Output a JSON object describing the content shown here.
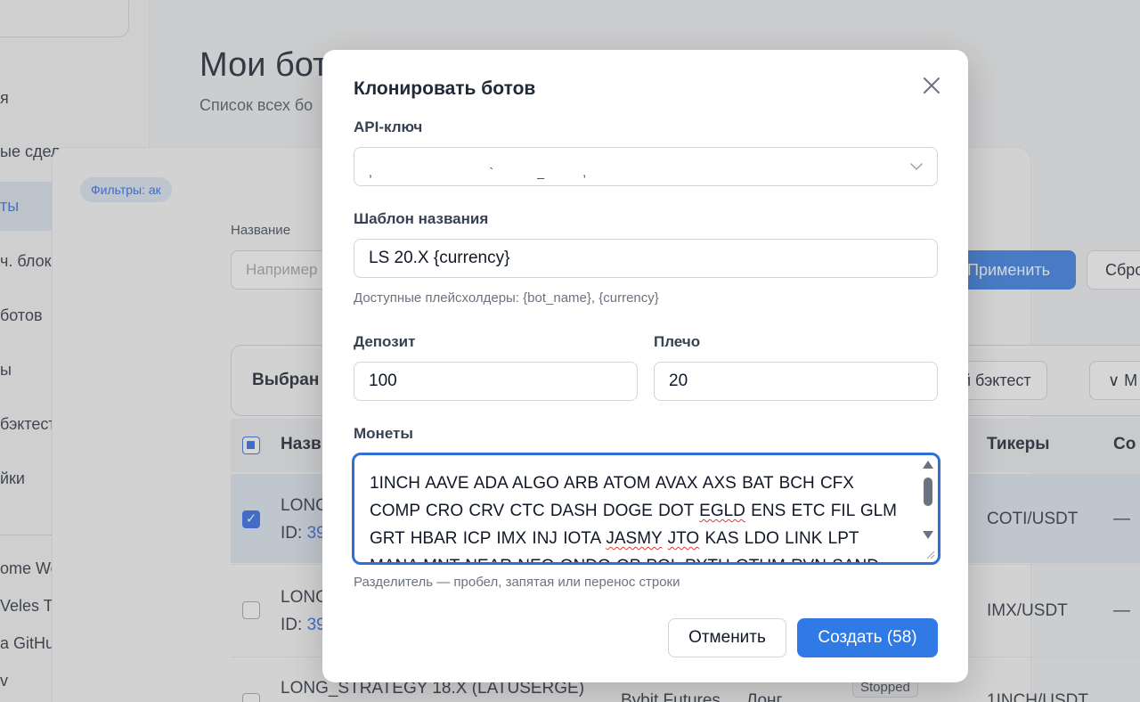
{
  "sidebar": {
    "items": [
      {
        "label": "я"
      },
      {
        "label": "ые сделки"
      },
      {
        "label": "ты"
      },
      {
        "label": "ч. блок."
      },
      {
        "label": " ботов"
      },
      {
        "label": "ы"
      },
      {
        "label": "бэктестов"
      },
      {
        "label": "йки"
      }
    ],
    "links": [
      {
        "label": "ome Web Store"
      },
      {
        "label": " Veles Tools"
      },
      {
        "label": "a GitHub"
      },
      {
        "label": "v"
      }
    ]
  },
  "page": {
    "title": "Мои бот",
    "subtitle": "Список всех бо"
  },
  "filters": {
    "chip": "Фильтры: ак",
    "name_label": "Название",
    "name_placeholder": "Например",
    "apply": "Применить",
    "reset": "Сбро"
  },
  "toolbar": {
    "label": "Выбран",
    "backtest": "ый бэктест",
    "more": "∨  М"
  },
  "table": {
    "headers": {
      "name": "Назв",
      "tickers": "Тикеры",
      "created": "Со"
    },
    "rows": [
      {
        "name": "LONG",
        "id_prefix": "ID: ",
        "id": "39",
        "ticker": "COTI/USDT",
        "created": "—"
      },
      {
        "name": "LONG",
        "id_prefix": "ID: ",
        "id": "39",
        "ticker": "IMX/USDT",
        "created": "—"
      },
      {
        "name": "LONG_STRATEGY 18.X (LATUSERGE)",
        "exchange": "Bybit Futures",
        "direction": "Лонг",
        "status": "Stopped",
        "ticker": "1INCH/USDT"
      }
    ]
  },
  "modal": {
    "title": "Клонировать ботов",
    "api_key_label": "API-ключ",
    "api_key_value": ",                      `        _       ,",
    "template_label": "Шаблон названия",
    "template_value": "LS 20.X {currency}",
    "template_hint": "Доступные плейсхолдеры: {bot_name}, {currency}",
    "deposit_label": "Депозит",
    "deposit_value": "100",
    "leverage_label": "Плечо",
    "leverage_value": "20",
    "coins_label": "Монеты",
    "coins_lines": {
      "l1": "1INCH AAVE ADA ALGO ARB ATOM AVAX AXS BAT BCH CFX",
      "l2a": "COMP CRO CRV CTC DASH DOGE DOT ",
      "l2b": "EGLD",
      "l2c": " ENS ETC FIL GLM",
      "l3a": "GRT HBAR ICP IMX INJ IOTA ",
      "l3b": "JASMY",
      "l3c": " ",
      "l3d": "JTO",
      "l3e": " KAS LDO LINK LPT",
      "l4": "MANA MNT NEAR NEO ONDO OP POL PYTH QTUM RVN SAND"
    },
    "coins_hint": "Разделитель — пробел, запятая или перенос строки",
    "cancel": "Отменить",
    "create": "Создать (58)"
  },
  "colors": {
    "accent": "#2f7ae5",
    "focus_border": "#2f6fd6",
    "overlay": "rgba(128,128,128,0.32)"
  }
}
